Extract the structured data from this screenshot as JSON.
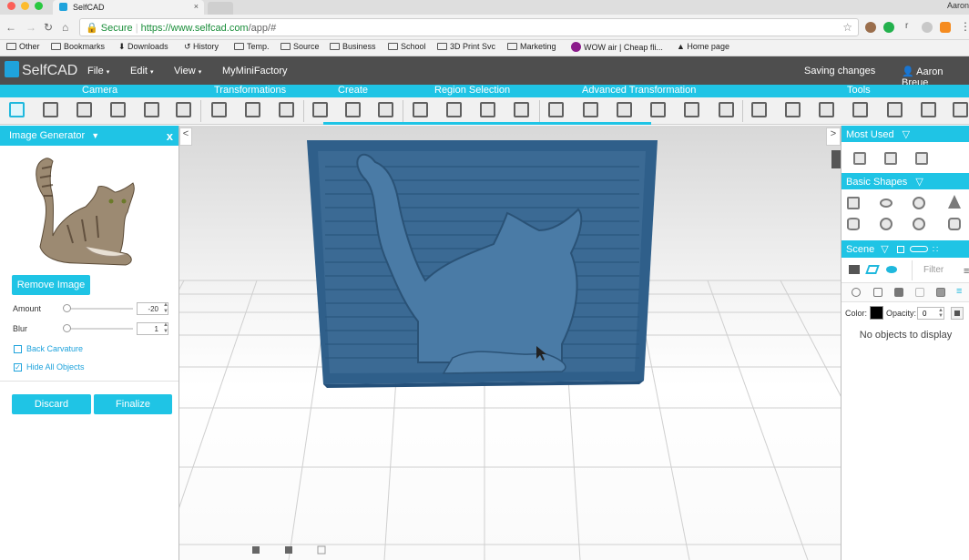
{
  "browser": {
    "tab_title": "SelfCAD",
    "tab_close": "×",
    "user_corner": "Aaron",
    "secure_label": "Secure",
    "url_host": "https://www.selfcad.com",
    "url_path": "/app/#",
    "ext_letter": "r",
    "bookmarks": [
      "Other",
      "Bookmarks",
      "Downloads",
      "History",
      "Temp.",
      "Source",
      "Business",
      "School",
      "3D Print Svc",
      "Marketing",
      "WOW air | Cheap fli...",
      "Home page"
    ]
  },
  "app": {
    "logo": "SelfCAD",
    "menus": [
      "File",
      "Edit",
      "View",
      "MyMiniFactory"
    ],
    "status": "Saving changes",
    "user": "Aaron Breue"
  },
  "toolbar": {
    "categories": [
      "Camera",
      "Transformations",
      "Create",
      "Region Selection",
      "Advanced Transformation",
      "Tools"
    ],
    "accent_color": "#1fc4e5"
  },
  "left_panel": {
    "title": "Image Generator",
    "close": "x",
    "remove_label": "Remove Image",
    "amount_label": "Amount",
    "amount_value": "-20",
    "blur_label": "Blur",
    "blur_value": "1",
    "back_curvature_label": "Back Carvature",
    "back_curvature_checked": false,
    "hide_all_label": "Hide All Objects",
    "hide_all_checked": true,
    "discard_label": "Discard",
    "finalize_label": "Finalize"
  },
  "right_panel": {
    "most_used": "Most Used",
    "basic_shapes": "Basic Shapes",
    "scene": "Scene",
    "filter_placeholder": "Filter",
    "color_label": "Color:",
    "color_value": "#000000",
    "opacity_label": "Opacity:",
    "opacity_value": "0",
    "no_objects": "No objects to display"
  },
  "viewport": {
    "model_color": "#3b6a94",
    "nav_left": "<",
    "nav_right": ">"
  }
}
